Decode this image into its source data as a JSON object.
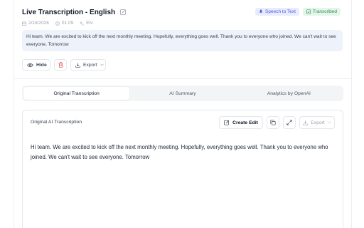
{
  "header": {
    "title": "Live Transcription - English",
    "badges": {
      "speech_to_text": "Speech to Text",
      "transcribed": "Transcribed"
    },
    "meta": {
      "date": "2/18/2026",
      "duration": "01:09",
      "language": "EN"
    }
  },
  "preview_text": "Hi team. We are excited to kick off the next monthly meeting. Hopefully, everything goes well. Thank you to everyone who joined. We can't wait to see everyone. Tomorrow",
  "toolbar": {
    "hide_label": "Hide",
    "export_label": "Export"
  },
  "tabs": [
    {
      "label": "Original Transcription",
      "active": true
    },
    {
      "label": "AI Summary",
      "active": false
    },
    {
      "label": "Analytics by OpenAI",
      "active": false
    }
  ],
  "card": {
    "heading": "Original AI Transcription",
    "create_edit_label": "Create Edit",
    "export_label": "Export",
    "body": "Hi team. We are excited to kick off the next monthly meeting. Hopefully, everything goes well. Thank you to everyone who joined. We can't wait to see everyone. Tomorrow"
  },
  "colors": {
    "accent_blue": "#4f5fd6",
    "success_green": "#2f8a51",
    "delete_red": "#e5484d",
    "preview_bg": "#eef2fb"
  },
  "icons": [
    "pencil-icon",
    "mic-icon",
    "check-doc-icon",
    "calendar-icon",
    "clock-icon",
    "translate-icon",
    "eye-icon",
    "trash-icon",
    "download-icon",
    "chevron-down-icon",
    "copy-icon",
    "expand-icon"
  ]
}
